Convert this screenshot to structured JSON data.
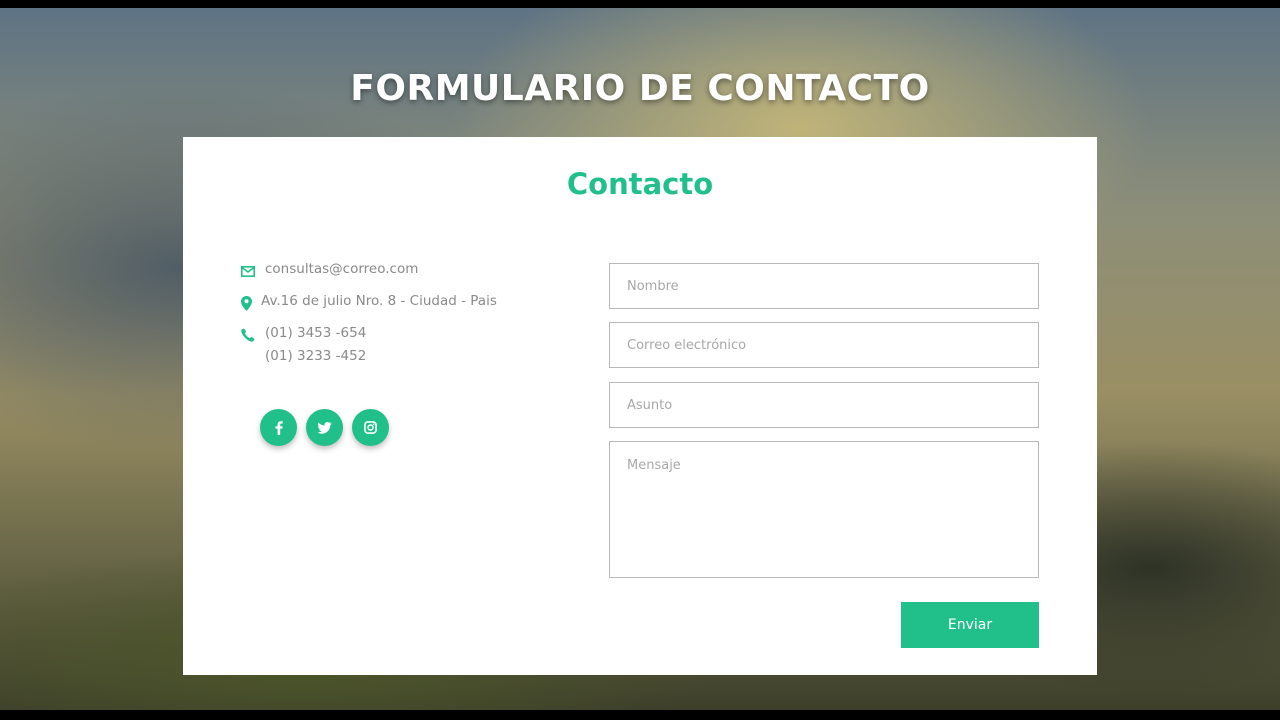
{
  "page": {
    "title": "FORMULARIO DE CONTACTO"
  },
  "card": {
    "title": "Contacto"
  },
  "contact_info": {
    "email": "consultas@correo.com",
    "address": "Av.16 de julio Nro. 8 - Ciudad - Pais",
    "phone_1": "(01) 3453 -654",
    "phone_2": "(01) 3233 -452"
  },
  "social": [
    {
      "icon": "facebook-icon"
    },
    {
      "icon": "twitter-icon"
    },
    {
      "icon": "instagram-icon"
    }
  ],
  "form": {
    "name_placeholder": "Nombre",
    "email_placeholder": "Correo electrónico",
    "subject_placeholder": "Asunto",
    "message_placeholder": "Mensaje",
    "submit_label": "Enviar"
  },
  "colors": {
    "accent": "#21c08b",
    "text_muted": "#8a8a8a"
  }
}
